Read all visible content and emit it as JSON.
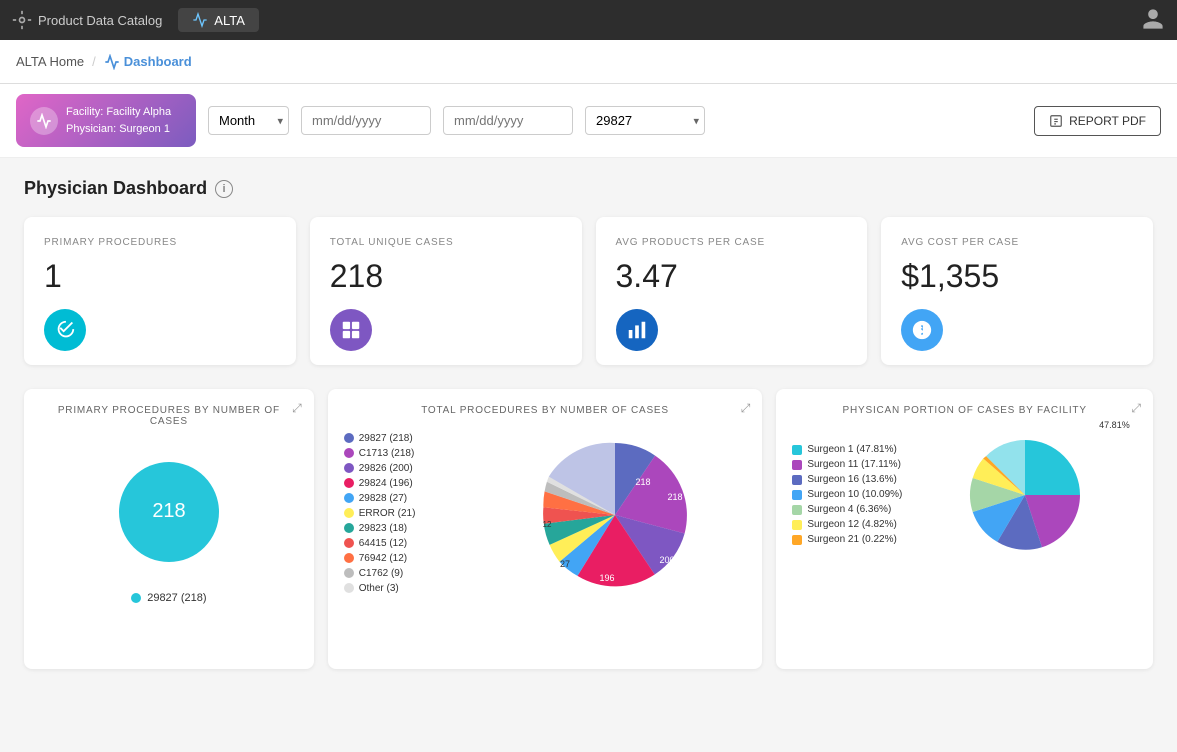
{
  "topNav": {
    "brand": "Product Data Catalog",
    "tab": "ALTA",
    "userIcon": "👤"
  },
  "subNav": {
    "home": "ALTA Home",
    "dashboard": "Dashboard"
  },
  "filterBar": {
    "facility": "Facility: Facility Alpha",
    "physician": "Physician: Surgeon 1",
    "periodLabel": "Month",
    "dateFrom": "mm/dd/yyyy",
    "dateTo": "mm/dd/yyyy",
    "procedureCode": "29827",
    "reportBtn": "REPORT PDF"
  },
  "dashboard": {
    "title": "Physician Dashboard",
    "kpis": [
      {
        "label": "PRIMARY PROCEDURES",
        "value": "1",
        "icon": "🔧",
        "iconClass": "cyan"
      },
      {
        "label": "TOTAL UNIQUE CASES",
        "value": "218",
        "icon": "▣",
        "iconClass": "purple"
      },
      {
        "label": "AVG PRODUCTS PER CASE",
        "value": "3.47",
        "icon": "📊",
        "iconClass": "blue"
      },
      {
        "label": "AVG COST PER CASE",
        "value": "$1,355",
        "icon": "$",
        "iconClass": "light-blue"
      }
    ]
  },
  "charts": {
    "primaryProcedures": {
      "title": "PRIMARY PROCEDURES BY NUMBER OF CASES",
      "legend": [
        {
          "label": "29827 (218)",
          "color": "#26c6da"
        }
      ],
      "centerLabel": "218",
      "slices": [
        {
          "pct": 100,
          "color": "#26c6da"
        }
      ]
    },
    "totalProcedures": {
      "title": "TOTAL PROCEDURES BY NUMBER OF CASES",
      "legend": [
        {
          "label": "29827 (218)",
          "color": "#5c6bc0"
        },
        {
          "label": "C1713 (218)",
          "color": "#ab47bc"
        },
        {
          "label": "29826 (200)",
          "color": "#7e57c2"
        },
        {
          "label": "29824 (196)",
          "color": "#e91e63"
        },
        {
          "label": "29828 (27)",
          "color": "#42a5f5"
        },
        {
          "label": "ERROR (21)",
          "color": "#ffee58"
        },
        {
          "label": "29823 (18)",
          "color": "#26a69a"
        },
        {
          "label": "64415 (12)",
          "color": "#ef5350"
        },
        {
          "label": "76942 (12)",
          "color": "#ff7043"
        },
        {
          "label": "C1762 (9)",
          "color": "#bdbdbd"
        },
        {
          "label": "Other (3)",
          "color": "#e0e0e0"
        }
      ],
      "sliceLabels": [
        "218",
        "218",
        "200",
        "196",
        "27",
        "12"
      ]
    },
    "physicianPortion": {
      "title": "PHYSICAN PORTION OF CASES BY FACILITY",
      "legend": [
        {
          "label": "Surgeon 1 (47.81%)",
          "color": "#26c6da"
        },
        {
          "label": "Surgeon 11 (17.11%)",
          "color": "#ab47bc"
        },
        {
          "label": "Surgeon 16 (13.6%)",
          "color": "#5c6bc0"
        },
        {
          "label": "Surgeon 10 (10.09%)",
          "color": "#42a5f5"
        },
        {
          "label": "Surgeon 4 (6.36%)",
          "color": "#a5d6a7"
        },
        {
          "label": "Surgeon 12 (4.82%)",
          "color": "#ffee58"
        },
        {
          "label": "Surgeon 21 (0.22%)",
          "color": "#ffa726"
        }
      ],
      "centerLabel": "47.81%"
    }
  }
}
